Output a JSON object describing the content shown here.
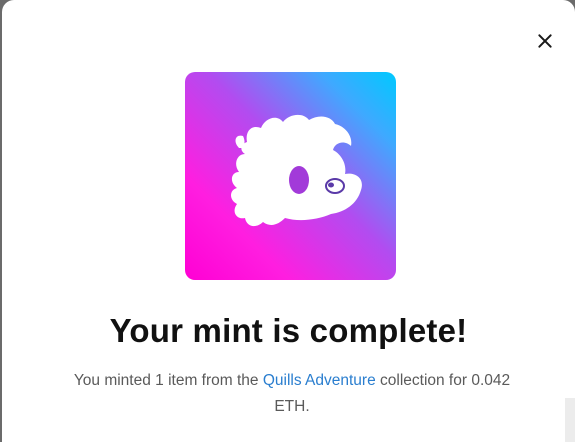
{
  "modal": {
    "close_icon": "close-icon",
    "image_icon": "quill-creature-logo",
    "title": "Your mint is complete!",
    "message": {
      "prefix": "You minted 1 item from the ",
      "collection_link": "Quills Adventure",
      "suffix": " collection for 0.042 ETH."
    }
  },
  "colors": {
    "gradient_cyan": "#00c9ff",
    "gradient_magenta": "#ff00d4",
    "link": "#2a7ecf",
    "title": "#111111"
  }
}
